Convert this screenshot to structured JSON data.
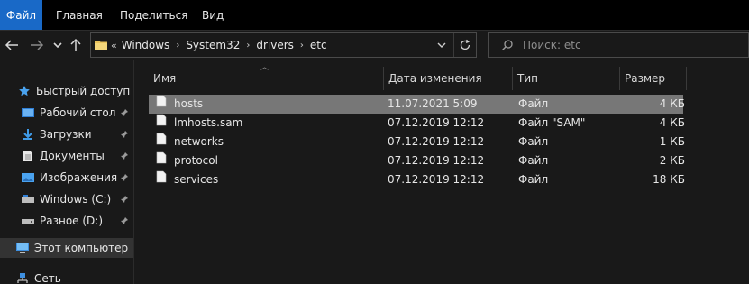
{
  "ribbon": {
    "tabs": [
      "Файл",
      "Главная",
      "Поделиться",
      "Вид"
    ]
  },
  "address": {
    "crumbs": [
      "Windows",
      "System32",
      "drivers",
      "etc"
    ]
  },
  "search": {
    "placeholder": "Поиск: etc"
  },
  "sidebar": {
    "items": [
      {
        "label": "Быстрый доступ",
        "icon": "star-icon",
        "pinned": false
      },
      {
        "label": "Рабочий стол",
        "icon": "desktop-icon",
        "pinned": true
      },
      {
        "label": "Загрузки",
        "icon": "download-icon",
        "pinned": true
      },
      {
        "label": "Документы",
        "icon": "documents-icon",
        "pinned": true
      },
      {
        "label": "Изображения",
        "icon": "pictures-icon",
        "pinned": true
      },
      {
        "label": "Windows (C:)",
        "icon": "drive-icon",
        "pinned": true
      },
      {
        "label": "Разное (D:)",
        "icon": "drive-icon",
        "pinned": true
      },
      {
        "label": "Этот компьютер",
        "icon": "computer-icon",
        "pinned": false,
        "selected": true
      },
      {
        "label": "Сеть",
        "icon": "network-icon",
        "pinned": false
      }
    ]
  },
  "columns": {
    "name": "Имя",
    "date": "Дата изменения",
    "type": "Тип",
    "size": "Размер"
  },
  "files": [
    {
      "name": "hosts",
      "date": "11.07.2021 5:09",
      "type": "Файл",
      "size": "4 КБ",
      "selected": true
    },
    {
      "name": "lmhosts.sam",
      "date": "07.12.2019 12:12",
      "type": "Файл \"SAM\"",
      "size": "4 КБ"
    },
    {
      "name": "networks",
      "date": "07.12.2019 12:12",
      "type": "Файл",
      "size": "1 КБ"
    },
    {
      "name": "protocol",
      "date": "07.12.2019 12:12",
      "type": "Файл",
      "size": "2 КБ"
    },
    {
      "name": "services",
      "date": "07.12.2019 12:12",
      "type": "Файл",
      "size": "18 КБ"
    }
  ],
  "colors": {
    "accent": "#1969c7",
    "background": "#191919",
    "selection": "#777777"
  }
}
